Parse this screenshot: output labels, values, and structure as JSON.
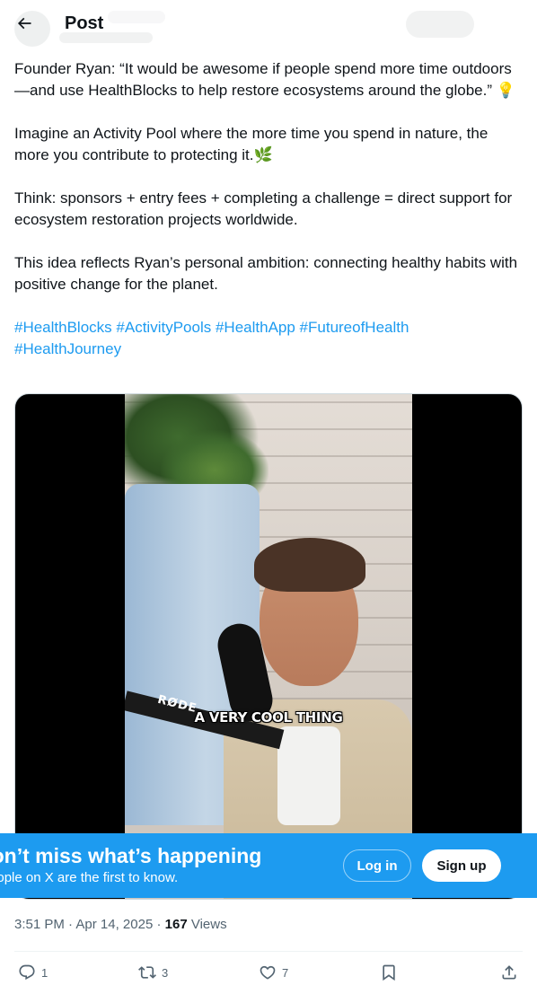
{
  "header": {
    "title": "Post",
    "back_label": "Back"
  },
  "tweet": {
    "paragraphs": [
      "Founder Ryan: “It would be awesome if people spend more time outdoors—and use HealthBlocks to help restore ecosystems around the globe.” 💡",
      "Imagine an Activity Pool where the more time you spend in nature, the more you contribute to protecting it.🌿",
      "Think: sponsors + entry fees + completing a challenge = direct support for ecosystem restoration projects worldwide.",
      "This idea reflects Ryan’s personal ambition: connecting healthy habits with positive change for the planet."
    ],
    "hashtags": [
      "#HealthBlocks",
      "#ActivityPools",
      "#HealthApp",
      "#FutureofHealth",
      "#HealthJourney"
    ]
  },
  "media": {
    "mic_brand": "RØDE",
    "caption": "A VERY COOL THING"
  },
  "meta": {
    "time": "3:51 PM",
    "date": "Apr 14, 2025",
    "separator": "·",
    "views_count": "167",
    "views_label": "Views"
  },
  "actions": {
    "replies": "1",
    "reposts": "3",
    "likes": "7"
  },
  "banner": {
    "title": "Don’t miss what’s happening",
    "subtitle": "People on X are the first to know.",
    "login_label": "Log in",
    "signup_label": "Sign up"
  },
  "colors": {
    "accent": "#1d9bf0",
    "text_primary": "#0f1419",
    "text_secondary": "#536471"
  }
}
